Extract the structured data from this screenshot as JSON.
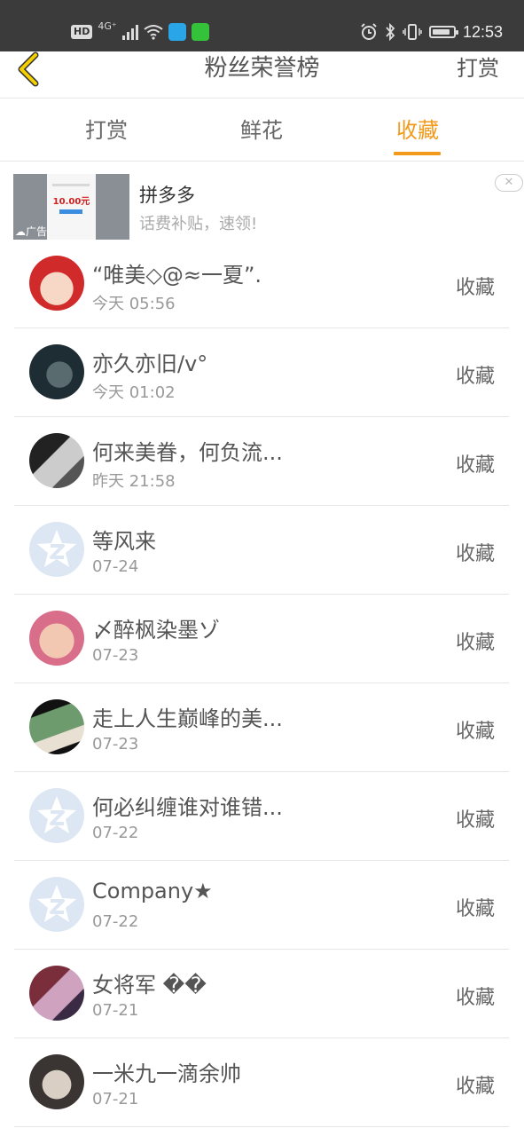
{
  "status_bar": {
    "hd": "HD",
    "network": "4G⁺",
    "time": "12:53",
    "battery_level": 0.85
  },
  "navbar": {
    "title": "粉丝荣誉榜",
    "right_action": "打赏"
  },
  "tabs": [
    {
      "label": "打赏",
      "active": false
    },
    {
      "label": "鲜花",
      "active": false
    },
    {
      "label": "收藏",
      "active": true
    }
  ],
  "colors": {
    "accent": "#f29a1c",
    "status_bar_bg": "#3b3b3b",
    "back_arrow": "#f5d000"
  },
  "ad": {
    "title": "拼多多",
    "subtitle": "话费补贴，速领!",
    "label": "广告",
    "thumb_price": "10.00元"
  },
  "list": [
    {
      "name": "“唯美◇@≈一夏”.",
      "time": "今天 05:56",
      "action": "收藏",
      "avatar": "cartoon-girl"
    },
    {
      "name": "亦久亦旧/v°",
      "time": "今天 01:02",
      "action": "收藏",
      "avatar": "photo-dark"
    },
    {
      "name": "何来美眷，何负流...",
      "time": "昨天 21:58",
      "action": "收藏",
      "avatar": "photo-gray"
    },
    {
      "name": "等风来",
      "time": "07-24",
      "action": "收藏",
      "avatar": "default-avatar"
    },
    {
      "name": "〆醉枫染墨ゾ",
      "time": "07-23",
      "action": "收藏",
      "avatar": "photo-kid"
    },
    {
      "name": "走上人生巅峰的美...",
      "time": "07-23",
      "action": "收藏",
      "avatar": "photo-people"
    },
    {
      "name": "何必纠缠谁对谁错...",
      "time": "07-22",
      "action": "收藏",
      "avatar": "default-avatar"
    },
    {
      "name": "Company★",
      "time": "07-22",
      "action": "收藏",
      "avatar": "default-avatar"
    },
    {
      "name": "女将军 ��",
      "time": "07-21",
      "action": "收藏",
      "avatar": "photo-pink"
    },
    {
      "name": "一米九一滴余帅",
      "time": "07-21",
      "action": "收藏",
      "avatar": "photo-bw"
    }
  ]
}
